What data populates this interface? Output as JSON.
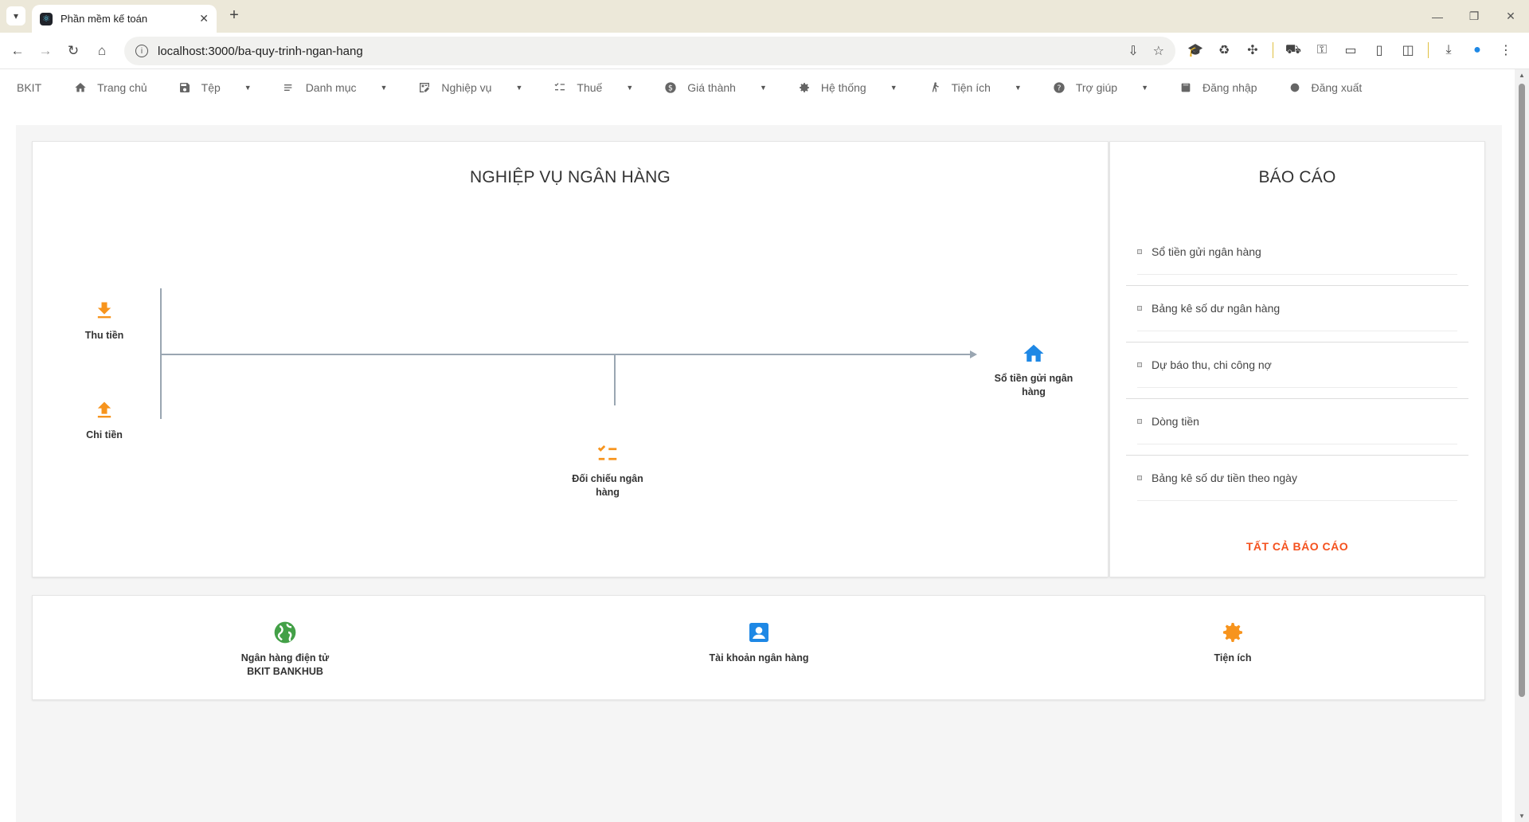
{
  "browser": {
    "tab_title": "Phần mềm kế toán",
    "url": "localhost:3000/ba-quy-trinh-ngan-hang"
  },
  "menu": {
    "brand": "BKIT",
    "items": [
      {
        "label": "Trang chủ",
        "icon": "home-icon",
        "dropdown": false
      },
      {
        "label": "Tệp",
        "icon": "save-icon",
        "dropdown": true
      },
      {
        "label": "Danh mục",
        "icon": "list-icon",
        "dropdown": true
      },
      {
        "label": "Nghiệp vụ",
        "icon": "edit-grid-icon",
        "dropdown": true
      },
      {
        "label": "Thuế",
        "icon": "checklist-icon",
        "dropdown": true
      },
      {
        "label": "Giá thành",
        "icon": "dollar-icon",
        "dropdown": true
      },
      {
        "label": "Hệ thống",
        "icon": "gear-icon",
        "dropdown": true
      },
      {
        "label": "Tiện ích",
        "icon": "walk-icon",
        "dropdown": true
      },
      {
        "label": "Trợ giúp",
        "icon": "help-icon",
        "dropdown": true
      },
      {
        "label": "Đăng nhập",
        "icon": "login-icon",
        "dropdown": false
      },
      {
        "label": "Đăng xuất",
        "icon": "logout-icon",
        "dropdown": false
      }
    ]
  },
  "banking": {
    "title": "NGHIỆP VỤ NGÂN HÀNG",
    "nodes": {
      "thu_tien": "Thu tiền",
      "chi_tien": "Chi tiền",
      "doi_chieu": "Đối chiếu ngân hàng",
      "so_tien_gui": "Sổ tiền gửi ngân hàng"
    }
  },
  "reports": {
    "title": "BÁO CÁO",
    "items": [
      "Sổ tiền gửi ngân hàng",
      "Bảng kê số dư ngân hàng",
      "Dự báo thu, chi công nợ",
      "Dòng tiền",
      "Bảng kê số dư tiền theo ngày"
    ],
    "all_label": "TẤT CẢ BÁO CÁO"
  },
  "utilities": {
    "items": [
      {
        "label": "Ngân hàng điện tử BKIT BANKHUB",
        "icon": "globe-icon"
      },
      {
        "label": "Tài khoản ngân hàng",
        "icon": "account-box-icon"
      },
      {
        "label": "Tiện ích",
        "icon": "gear-icon"
      }
    ]
  },
  "colors": {
    "accent_orange": "#f7941d",
    "blue": "#1e88e5",
    "green": "#43a047",
    "link_red": "#f4511e"
  }
}
